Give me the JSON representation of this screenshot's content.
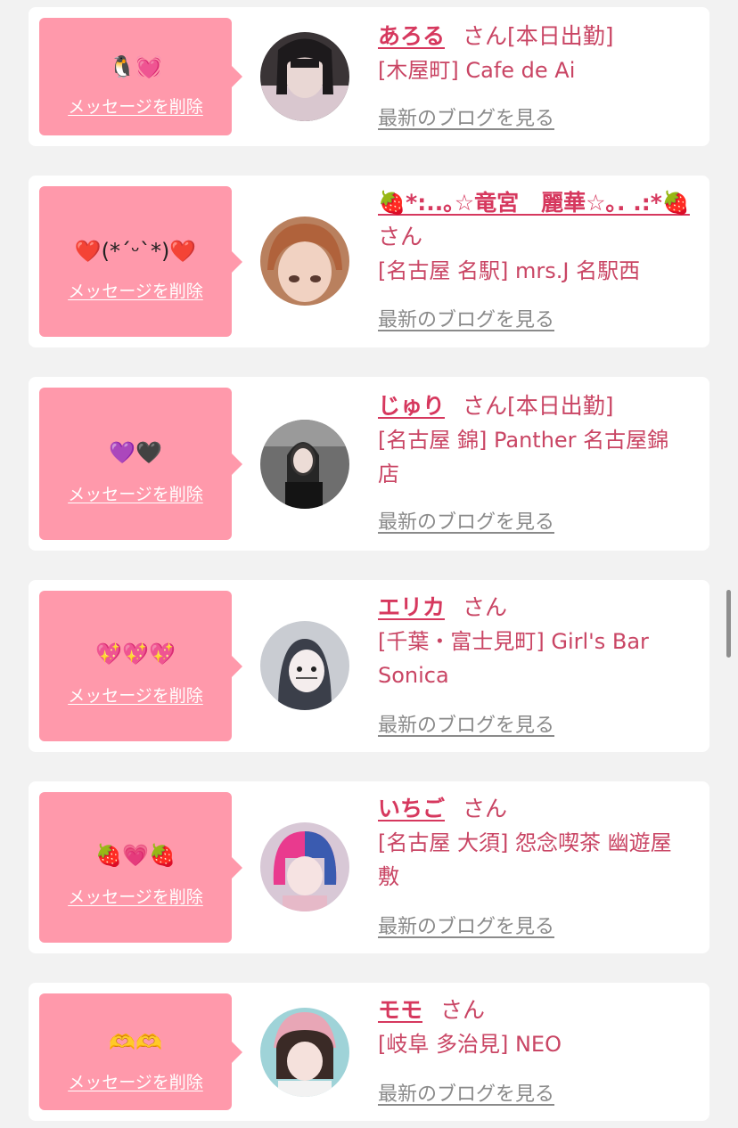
{
  "theme": {
    "bubble_color": "#ff99ab",
    "name_color": "#d6385e",
    "shop_color": "#c94564",
    "link_color": "#8a8a8a"
  },
  "entries": [
    {
      "message": "🐧💓",
      "delete_label": "メッセージを削除",
      "name": "あろる",
      "honorific": "さん",
      "status": "[本日出勤]",
      "shop": "[木屋町] Cafe de Ai",
      "blog_label": "最新のブログを見る",
      "avatar": "avatar-photo-1"
    },
    {
      "message": "❤️(*´ᵕ`*)❤️",
      "delete_label": "メッセージを削除",
      "name": "🍓*:..｡☆竜宮　麗華☆｡. .:*🍓",
      "honorific": "さん",
      "status": "",
      "shop": "[名古屋 名駅] mrs.J 名駅西",
      "blog_label": "最新のブログを見る",
      "avatar": "avatar-photo-2"
    },
    {
      "message": "💜🖤",
      "delete_label": "メッセージを削除",
      "name": "じゅり",
      "honorific": "さん",
      "status": "[本日出勤]",
      "shop": "[名古屋 錦] Panther 名古屋錦店",
      "blog_label": "最新のブログを見る",
      "avatar": "avatar-photo-3"
    },
    {
      "message": "💖💖💖",
      "delete_label": "メッセージを削除",
      "name": "エリカ",
      "honorific": "さん",
      "status": "",
      "shop": "[千葉・富士見町] Girl's Bar Sonica",
      "blog_label": "最新のブログを見る",
      "avatar": "avatar-photo-4"
    },
    {
      "message": "🍓💗🍓",
      "delete_label": "メッセージを削除",
      "name": "いちご",
      "honorific": "さん",
      "status": "",
      "shop": "[名古屋 大須] 怨念喫茶 幽遊屋敷",
      "blog_label": "最新のブログを見る",
      "avatar": "avatar-photo-5"
    },
    {
      "message": "🫶🫶",
      "delete_label": "メッセージを削除",
      "name": "モモ",
      "honorific": "さん",
      "status": "",
      "shop": "[岐阜 多治見] NEO",
      "blog_label": "最新のブログを見る",
      "avatar": "avatar-photo-6"
    }
  ]
}
